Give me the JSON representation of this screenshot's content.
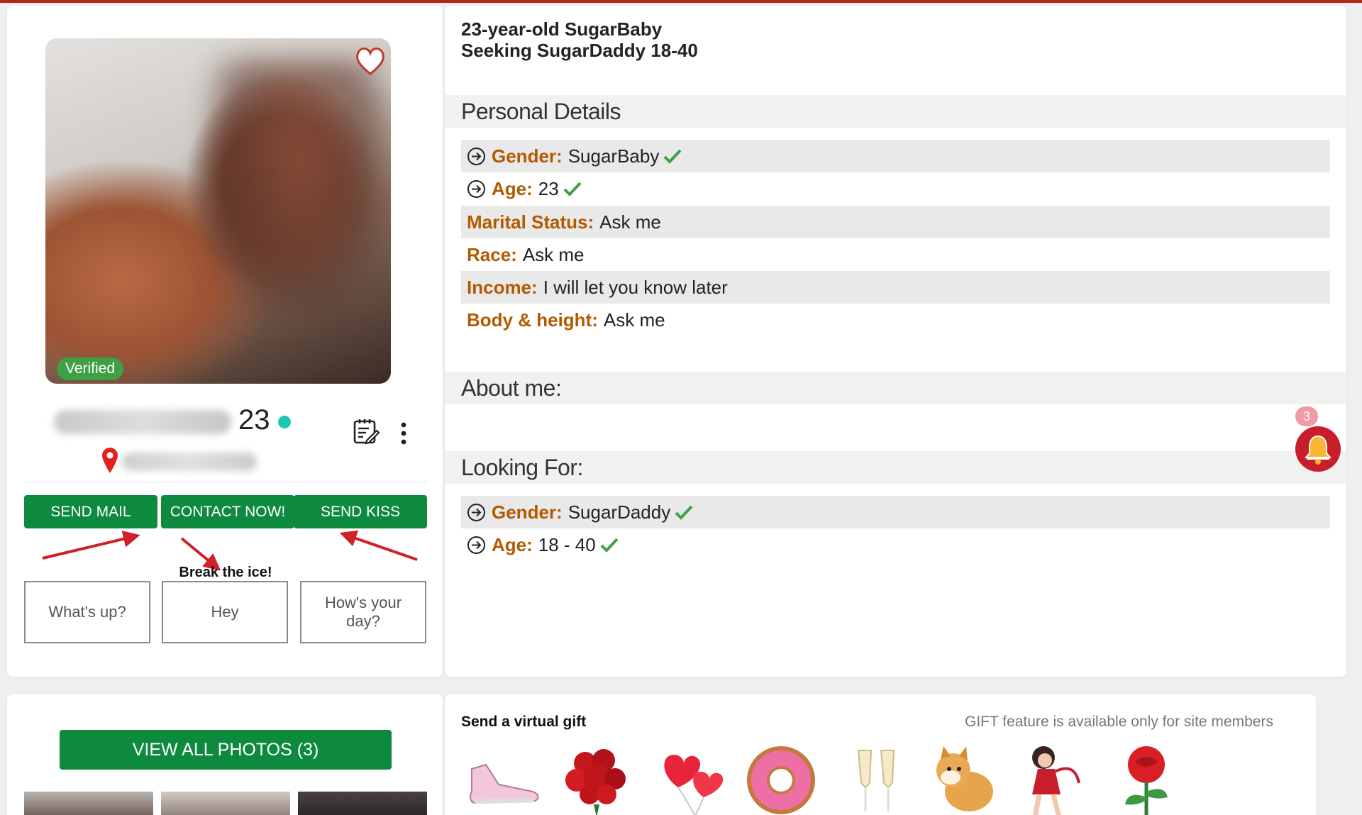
{
  "profile": {
    "age": "23",
    "verified_label": "Verified",
    "headline_line1": "23-year-old SugarBaby",
    "headline_line2": "Seeking SugarDaddy 18-40"
  },
  "actions": {
    "send_mail": "SEND MAIL",
    "contact_now": "CONTACT NOW!",
    "send_kiss": "SEND KISS"
  },
  "icebreakers": {
    "label": "Break the ice!",
    "options": [
      "What's up?",
      "Hey",
      "How's your day?"
    ]
  },
  "personal_details": {
    "title": "Personal Details",
    "rows": [
      {
        "label": "Gender:",
        "value": "SugarBaby"
      },
      {
        "label": "Age:",
        "value": "23"
      },
      {
        "label": "Marital Status:",
        "value": "Ask me"
      },
      {
        "label": "Race:",
        "value": "Ask me"
      },
      {
        "label": "Income:",
        "value": "I will let you know later"
      },
      {
        "label": "Body & height:",
        "value": "Ask me"
      }
    ]
  },
  "about": {
    "title": "About me:"
  },
  "looking_for": {
    "title": "Looking For:",
    "rows": [
      {
        "label": "Gender:",
        "value": "SugarDaddy"
      },
      {
        "label": "Age:",
        "value": "18 - 40"
      }
    ]
  },
  "notifications": {
    "count": "3"
  },
  "photos": {
    "view_all_label": "VIEW ALL PHOTOS (3)"
  },
  "gifts": {
    "title": "Send a virtual gift",
    "note": "GIFT feature is available only for site members",
    "items": [
      "sneaker-gift",
      "roses-bouquet-gift",
      "heart-balloons-gift",
      "donut-gift",
      "champagne-gift",
      "shiba-dog-gift",
      "pinup-girl-gift",
      "rose-gift"
    ]
  },
  "colors": {
    "primary_green": "#0e8a3e",
    "label_brown": "#b35a00",
    "check_green": "#3fa047",
    "online_teal": "#1fc7b1",
    "bell_red": "#c81e2c",
    "top_bar_red": "#b3261e"
  }
}
